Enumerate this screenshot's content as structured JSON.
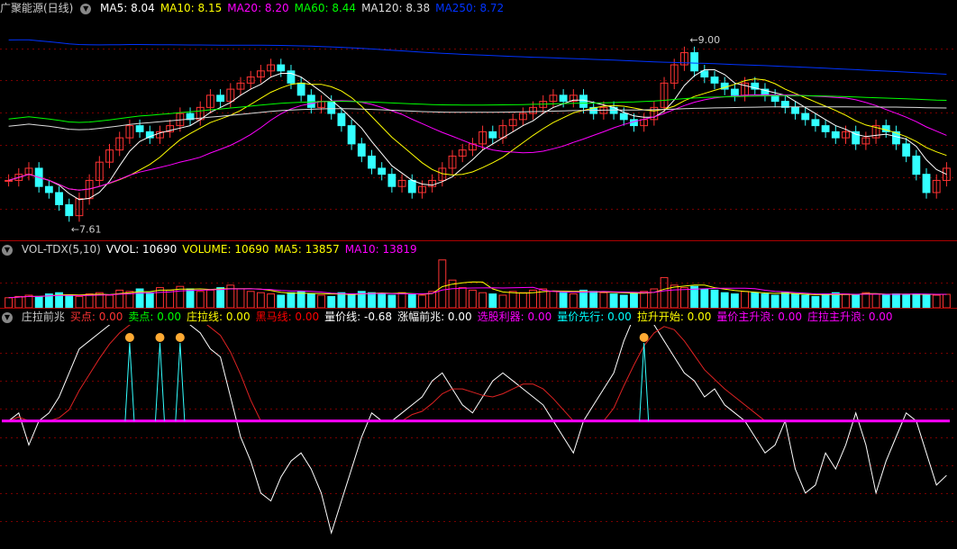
{
  "stock": {
    "title": "广聚能源(日线)"
  },
  "ma_legend": [
    {
      "label": "MA5:",
      "value": "8.04",
      "color": "#ffffff"
    },
    {
      "label": "MA10:",
      "value": "8.15",
      "color": "#ffff00"
    },
    {
      "label": "MA20:",
      "value": "8.20",
      "color": "#ff00ff"
    },
    {
      "label": "MA60:",
      "value": "8.44",
      "color": "#00ff00"
    },
    {
      "label": "MA120:",
      "value": "8.38",
      "color": "#dddddd"
    },
    {
      "label": "MA250:",
      "value": "8.72",
      "color": "#0033ff"
    }
  ],
  "price_annotations": {
    "high": "9.00",
    "low": "7.61"
  },
  "vol_legend": [
    {
      "label": "VOL-TDX(5,10)",
      "value": "",
      "color": "#cccccc"
    },
    {
      "label": "VVOL:",
      "value": "10690",
      "color": "#ffffff"
    },
    {
      "label": "VOLUME:",
      "value": "10690",
      "color": "#ffff00"
    },
    {
      "label": "MA5:",
      "value": "13857",
      "color": "#ffff00"
    },
    {
      "label": "MA10:",
      "value": "13819",
      "color": "#ff00ff"
    }
  ],
  "ind_legend": [
    {
      "label": "庄拉前兆",
      "value": "",
      "color": "#cccccc"
    },
    {
      "label": "买点:",
      "value": "0.00",
      "color": "#ff3333"
    },
    {
      "label": "卖点:",
      "value": "0.00",
      "color": "#00ff00"
    },
    {
      "label": "庄拉线:",
      "value": "0.00",
      "color": "#ffff00"
    },
    {
      "label": "黑马线:",
      "value": "0.00",
      "color": "#ff0000"
    },
    {
      "label": "量价线:",
      "value": "-0.68",
      "color": "#ffffff"
    },
    {
      "label": "涨幅前兆:",
      "value": "0.00",
      "color": "#ffffff"
    },
    {
      "label": "选股利器:",
      "value": "0.00",
      "color": "#ff00ff"
    },
    {
      "label": "量价先行:",
      "value": "0.00",
      "color": "#00ffff"
    },
    {
      "label": "拉升开始:",
      "value": "0.00",
      "color": "#ffff00"
    },
    {
      "label": "量价主升浪:",
      "value": "0.00",
      "color": "#ff00ff"
    },
    {
      "label": "庄拉主升浪:",
      "value": "0.00",
      "color": "#ff00ff"
    }
  ],
  "chart_data": [
    {
      "type": "candlestick",
      "ylim": [
        7.4,
        9.25
      ],
      "closes": [
        7.9,
        7.95,
        8.0,
        7.85,
        7.8,
        7.7,
        7.61,
        7.75,
        7.9,
        8.05,
        8.15,
        8.25,
        8.35,
        8.3,
        8.25,
        8.3,
        8.35,
        8.45,
        8.4,
        8.5,
        8.6,
        8.55,
        8.65,
        8.7,
        8.75,
        8.8,
        8.85,
        8.8,
        8.7,
        8.6,
        8.5,
        8.55,
        8.45,
        8.35,
        8.2,
        8.1,
        8.0,
        7.95,
        7.85,
        7.9,
        7.8,
        7.85,
        7.9,
        8.0,
        8.1,
        8.15,
        8.2,
        8.3,
        8.25,
        8.35,
        8.4,
        8.45,
        8.5,
        8.55,
        8.6,
        8.55,
        8.6,
        8.5,
        8.45,
        8.5,
        8.45,
        8.4,
        8.35,
        8.4,
        8.5,
        8.7,
        8.85,
        8.95,
        8.8,
        8.75,
        8.7,
        8.65,
        8.6,
        8.7,
        8.65,
        8.6,
        8.55,
        8.5,
        8.45,
        8.4,
        8.35,
        8.3,
        8.25,
        8.3,
        8.2,
        8.25,
        8.35,
        8.3,
        8.2,
        8.1,
        7.95,
        7.8,
        7.9,
        8.0
      ],
      "volume_ylim": [
        0,
        40000
      ],
      "volumes": [
        8000,
        9000,
        10000,
        9000,
        11000,
        12000,
        10000,
        9000,
        11000,
        12000,
        10000,
        14000,
        13000,
        15000,
        12000,
        16000,
        14000,
        17000,
        15000,
        13000,
        14000,
        16000,
        18000,
        15000,
        13000,
        12000,
        11000,
        10000,
        12000,
        13000,
        11000,
        10000,
        9000,
        12000,
        11000,
        13000,
        12000,
        11000,
        10000,
        12000,
        11000,
        10000,
        13000,
        38000,
        22000,
        16000,
        14000,
        12000,
        11000,
        10000,
        13000,
        12000,
        14000,
        15000,
        13000,
        12000,
        11000,
        14000,
        13000,
        12000,
        11000,
        10000,
        12000,
        13000,
        15000,
        24000,
        18000,
        16000,
        17000,
        15000,
        14000,
        12000,
        11000,
        13000,
        12000,
        11000,
        10000,
        12000,
        11000,
        10000,
        9000,
        11000,
        12000,
        11000,
        10000,
        12000,
        11000,
        10000,
        11000,
        10690,
        11000,
        10690,
        10000,
        10690
      ]
    },
    {
      "type": "line",
      "ylim": [
        -1.6,
        1.2
      ],
      "values": [
        0,
        0.1,
        -0.3,
        0,
        0.1,
        0.3,
        0.6,
        0.9,
        1.0,
        1.1,
        1.2,
        1.3,
        1.4,
        1.3,
        1.35,
        1.4,
        1.3,
        1.35,
        1.2,
        1.1,
        0.9,
        0.8,
        0.3,
        -0.2,
        -0.5,
        -0.9,
        -1.0,
        -0.7,
        -0.5,
        -0.4,
        -0.6,
        -0.9,
        -1.4,
        -1.0,
        -0.6,
        -0.2,
        0.1,
        0.0,
        0.0,
        0.1,
        0.2,
        0.3,
        0.5,
        0.6,
        0.4,
        0.2,
        0.1,
        0.3,
        0.5,
        0.6,
        0.5,
        0.4,
        0.3,
        0.2,
        0.0,
        -0.2,
        -0.4,
        0.0,
        0.2,
        0.4,
        0.6,
        1.0,
        1.3,
        1.4,
        1.2,
        1.0,
        0.8,
        0.6,
        0.5,
        0.3,
        0.4,
        0.2,
        0.1,
        0.0,
        -0.2,
        -0.4,
        -0.3,
        0.0,
        -0.6,
        -0.9,
        -0.8,
        -0.4,
        -0.6,
        -0.3,
        0.1,
        -0.3,
        -0.9,
        -0.5,
        -0.2,
        0.1,
        0.0,
        -0.4,
        -0.8,
        -0.68
      ]
    }
  ]
}
